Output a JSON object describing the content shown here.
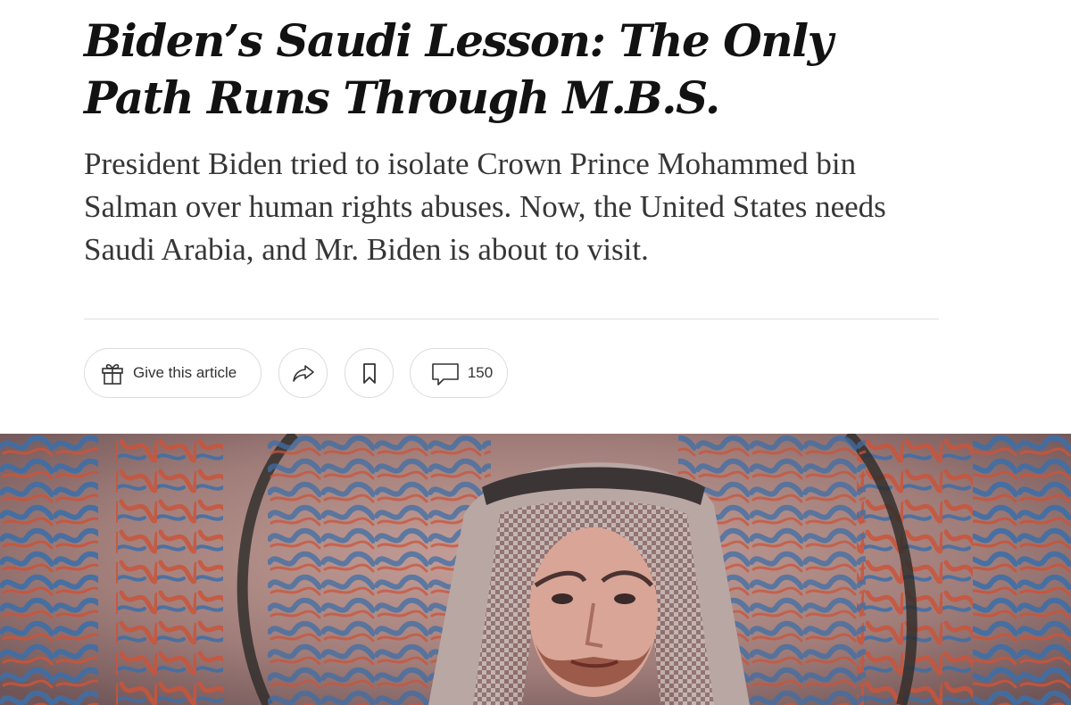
{
  "article": {
    "headline": "Biden’s Saudi Lesson: The Only Path Runs Through M.B.S.",
    "summary": "President Biden tried to isolate Crown Prince Mohammed bin Salman over human rights abuses. Now, the United States needs Saudi Arabia, and Mr. Biden is about to visit."
  },
  "toolbar": {
    "gift_label": "Give this article",
    "gift_icon": "gift-icon",
    "share_icon": "share-arrow-icon",
    "save_icon": "bookmark-icon",
    "comments_icon": "comment-bubble-icon",
    "comment_count": "150"
  },
  "hero_image": {
    "description": "mural-portrait-with-arabic-calligraphy",
    "colors": {
      "background": "#9e7a77",
      "calligraphy_blue": "#3e6ea6",
      "calligraphy_red": "#c9543b",
      "ring_dark": "#2c2a28"
    }
  }
}
